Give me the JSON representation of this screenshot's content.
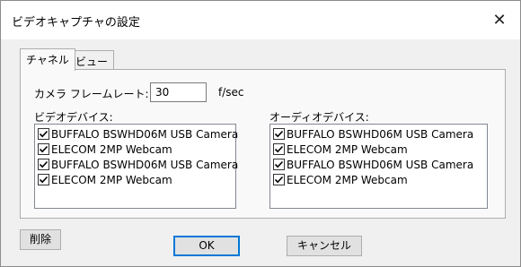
{
  "window": {
    "title": "ビデオキャプチャの設定",
    "close_glyph": "✕"
  },
  "tabs": [
    {
      "label": "チャネル"
    },
    {
      "label": "ビュー"
    }
  ],
  "channel": {
    "frame_rate_label": "カメラ フレームレート:",
    "frame_rate_value": "30",
    "frame_rate_unit": "f/sec",
    "video_devices_label": "ビデオデバイス:",
    "video_devices": [
      {
        "label": "BUFFALO BSWHD06M USB Camera",
        "checked": true
      },
      {
        "label": "ELECOM 2MP Webcam",
        "checked": true
      },
      {
        "label": "BUFFALO BSWHD06M USB Camera",
        "checked": true
      },
      {
        "label": "ELECOM 2MP Webcam",
        "checked": true
      }
    ],
    "audio_devices_label": "オーディオデバイス:",
    "audio_devices": [
      {
        "label": "BUFFALO BSWHD06M USB Camera",
        "checked": true
      },
      {
        "label": "ELECOM 2MP Webcam",
        "checked": true
      },
      {
        "label": "BUFFALO BSWHD06M USB Camera",
        "checked": true
      },
      {
        "label": "ELECOM 2MP Webcam",
        "checked": true
      }
    ]
  },
  "buttons": {
    "delete": "削除",
    "ok": "OK",
    "cancel": "キャンセル"
  },
  "colors": {
    "accent": "#0078d7",
    "face": "#f0f0f0"
  }
}
